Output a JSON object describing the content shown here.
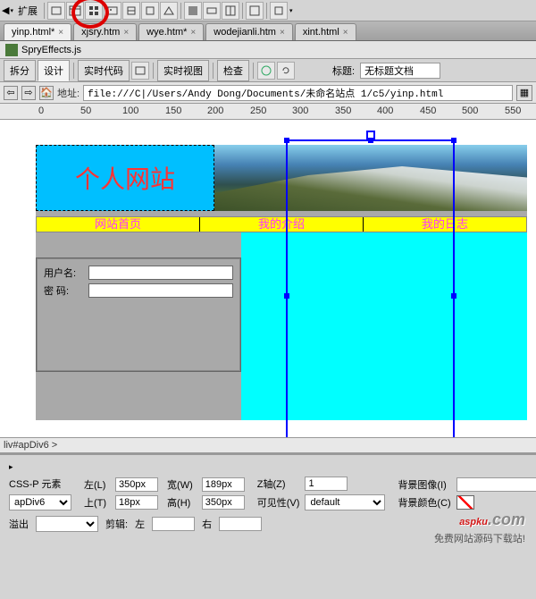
{
  "menu": {
    "expand": "扩展"
  },
  "tabs": [
    {
      "label": "yinp.html*",
      "active": true
    },
    {
      "label": "xjsry.htm"
    },
    {
      "label": "wye.htm*"
    },
    {
      "label": "wodejianli.htm"
    },
    {
      "label": "xint.html"
    }
  ],
  "spry": {
    "file": "SpryEffects.js"
  },
  "viewbar": {
    "split": "拆分",
    "design": "设计",
    "liveCode": "实时代码",
    "liveView": "实时视图",
    "inspect": "检查",
    "titleLabel": "标题:",
    "titleValue": "无标题文档"
  },
  "address": {
    "label": "地址:",
    "value": "file:///C|/Users/Andy Dong/Documents/未命名站点 1/c5/yinp.html"
  },
  "ruler": {
    "marks": [
      "0",
      "50",
      "100",
      "150",
      "200",
      "250",
      "300",
      "350",
      "400",
      "450",
      "500",
      "550"
    ]
  },
  "page": {
    "logo": "个人网站",
    "nav": [
      "网站首页",
      "我的介绍",
      "我的日志"
    ],
    "form": {
      "user": "用户名:",
      "pass": "密  码:"
    }
  },
  "tagpath": "liv#apDiv6 >",
  "props": {
    "cssp": "CSS-P 元素",
    "element": "apDiv6",
    "leftL": "左(L)",
    "leftV": "350px",
    "widthL": "宽(W)",
    "widthV": "189px",
    "zL": "Z轴(Z)",
    "zV": "1",
    "bgimgL": "背景图像(I)",
    "topL": "上(T)",
    "topV": "18px",
    "heightL": "高(H)",
    "heightV": "350px",
    "visL": "可见性(V)",
    "visV": "default",
    "bgcolorL": "背景颜色(C)",
    "overflowL": "溢出",
    "clipL": "剪辑:",
    "clipLeft": "左",
    "clipRight": "右"
  },
  "watermark": {
    "main": "aspku",
    "com": ".com",
    "sub": "免费网站源码下载站!"
  }
}
